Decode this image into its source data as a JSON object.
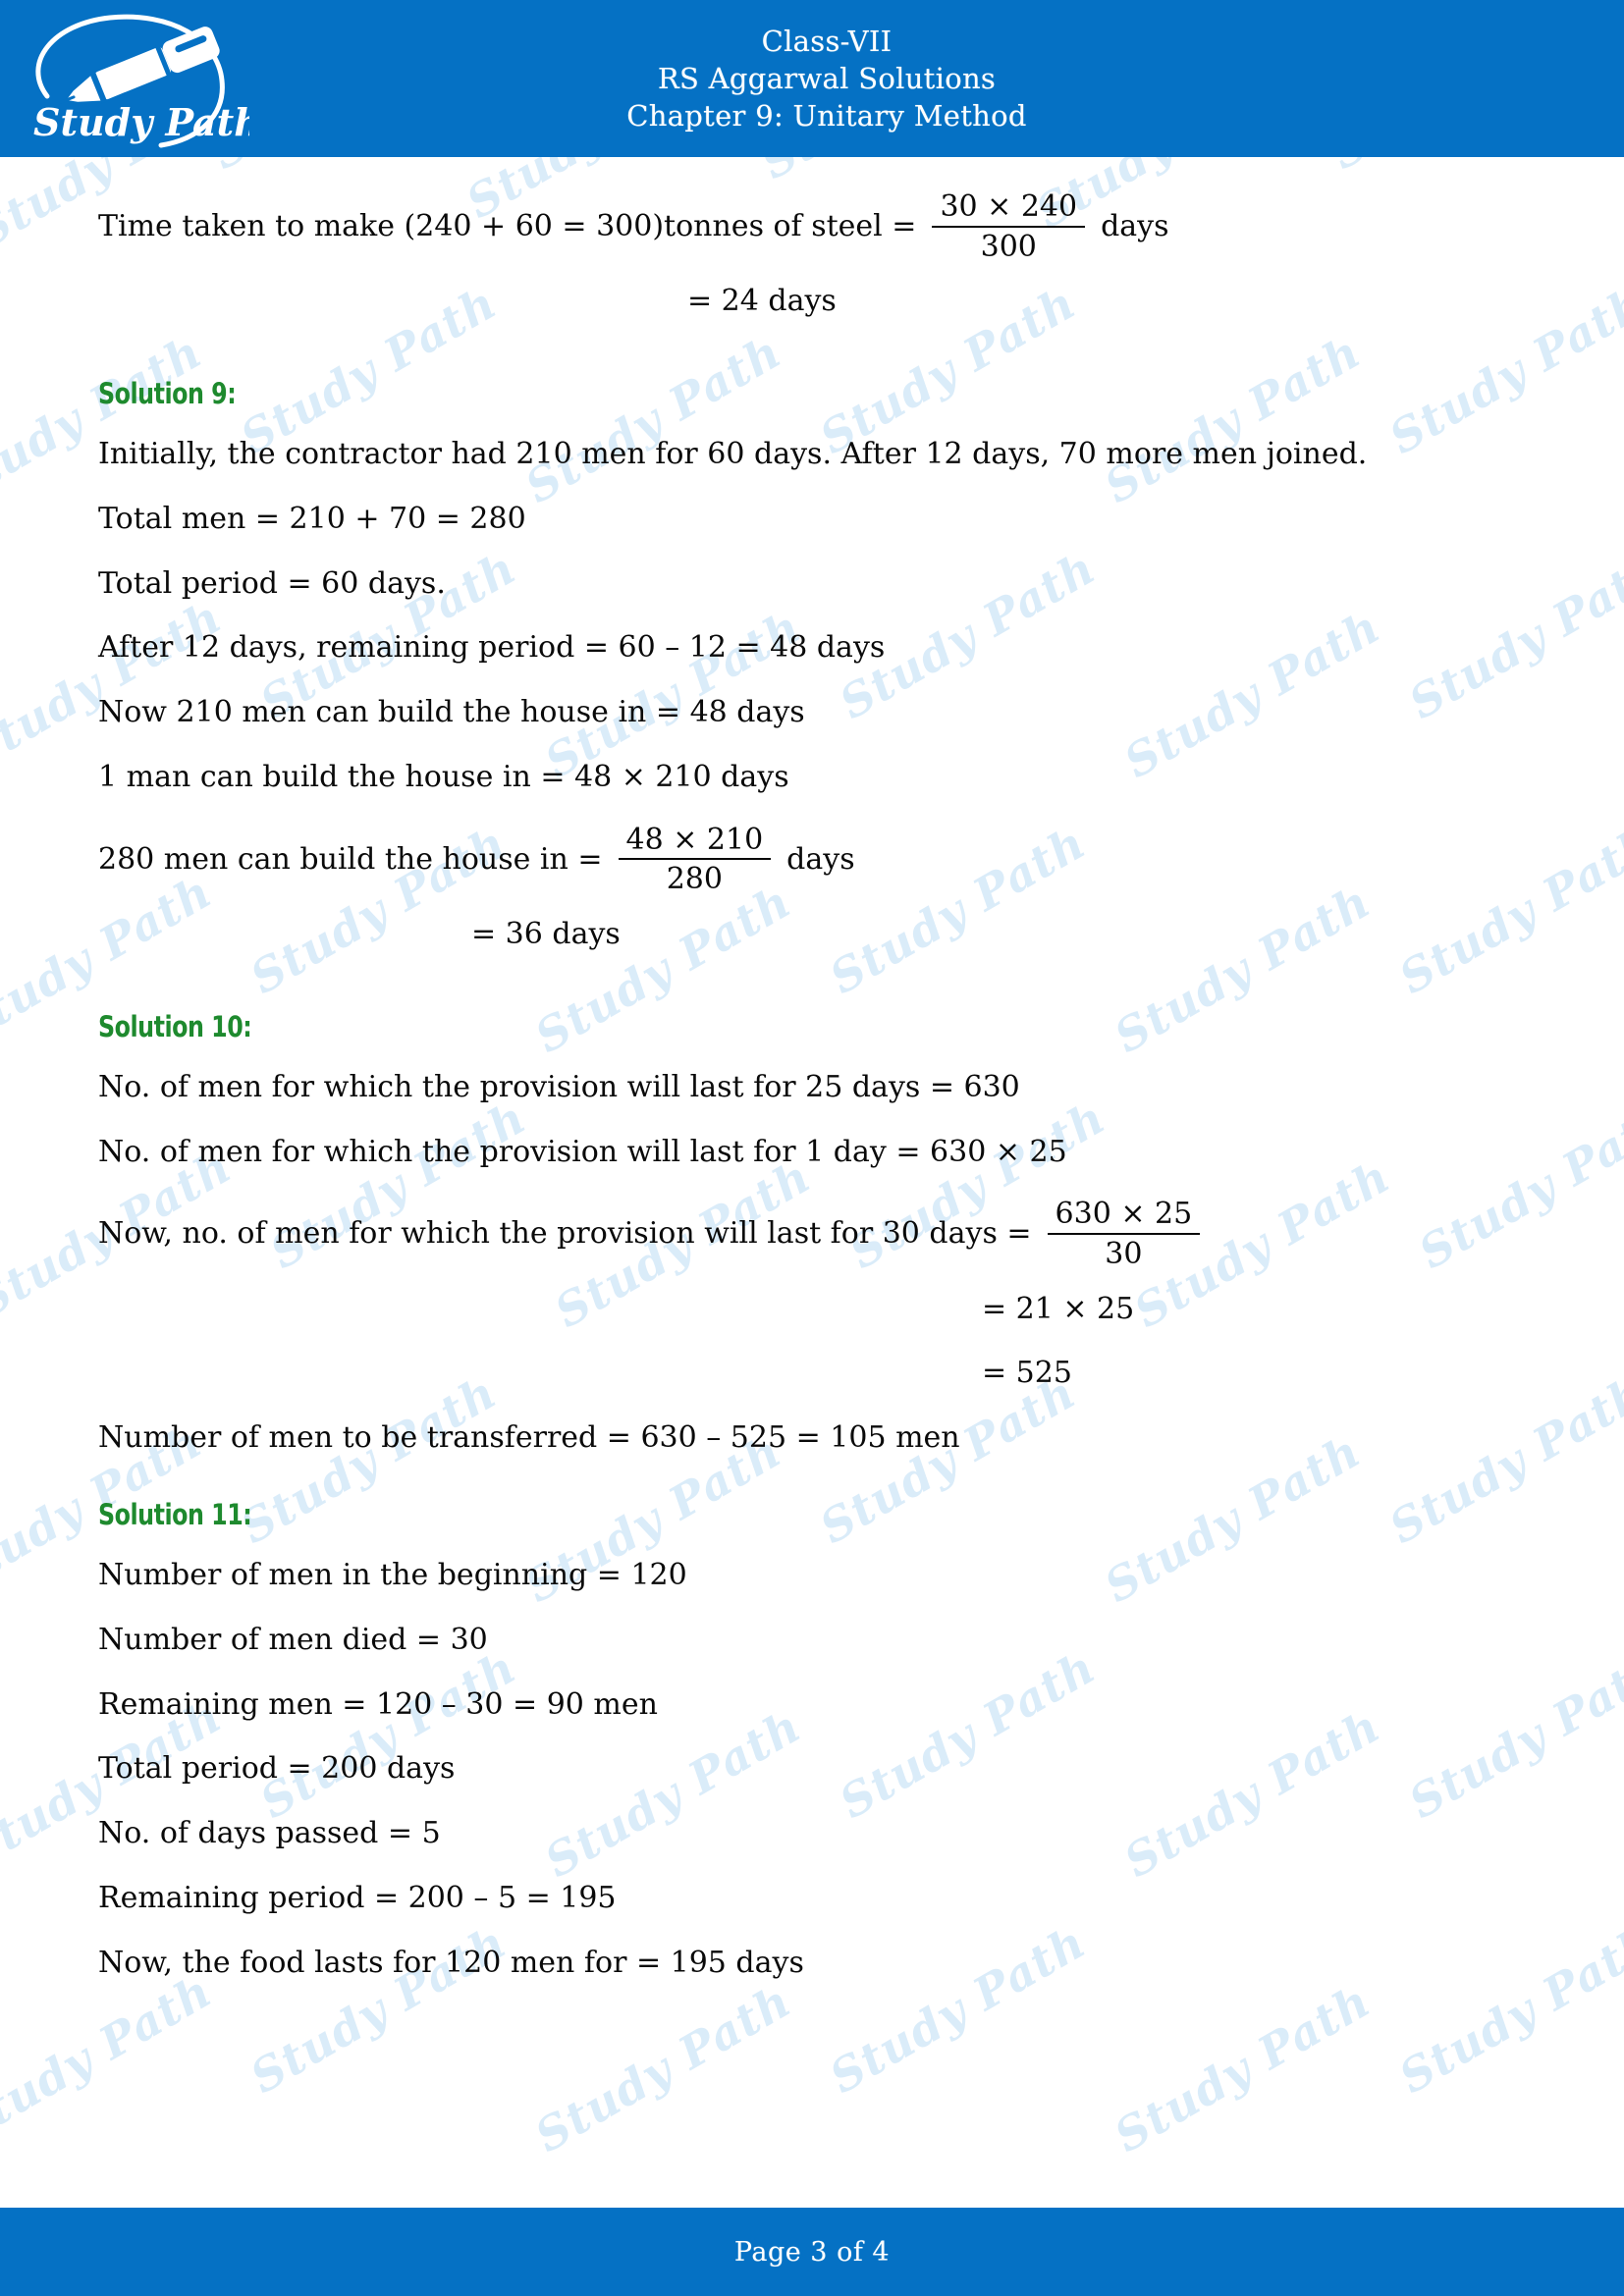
{
  "header": {
    "line1": "Class-VII",
    "line2": "RS Aggarwal Solutions",
    "line3": "Chapter 9: Unitary Method",
    "logo_text": "Study Path",
    "background_color": "#0571c4"
  },
  "watermark": {
    "text": "Study Path",
    "color": "#d9ebf9"
  },
  "body": {
    "carryover": {
      "lead": "Time taken to make (240 + 60 = 300)tonnes of steel =",
      "frac_num": "30 × 240",
      "frac_den": "300",
      "unit": "days",
      "result": "= 24 days"
    },
    "solution9": {
      "heading": "Solution 9:",
      "l1": "Initially, the contractor had 210 men for 60 days. After 12 days, 70 more men joined.",
      "l2": "Total men = 210 + 70 = 280",
      "l3": "Total period = 60 days.",
      "l4": "After 12 days, remaining period = 60 – 12 = 48 days",
      "l5": "Now 210 men can build the house in = 48 days",
      "l6": "1 man can build the house in = 48 × 210 days",
      "l7_lead": "280 men can build the house in =",
      "l7_num": "48 × 210",
      "l7_den": "280",
      "l7_unit": "days",
      "l8": "= 36 days"
    },
    "solution10": {
      "heading": "Solution 10:",
      "l1": "No. of men for which the provision will last for 25 days = 630",
      "l2": "No. of men for which the provision will last for 1 day = 630 × 25",
      "l3_lead": "Now, no. of men for which the provision will last for 30 days =",
      "l3_num": "630 × 25",
      "l3_den": "30",
      "l4": "= 21 × 25",
      "l5": "= 525",
      "l6": "Number of men to be transferred = 630 – 525 = 105 men"
    },
    "solution11": {
      "heading": "Solution 11:",
      "l1": "Number of men in the beginning = 120",
      "l2": "Number of men died = 30",
      "l3": "Remaining men = 120 – 30 = 90 men",
      "l4": "Total period = 200 days",
      "l5": "No. of days passed = 5",
      "l6": "Remaining period = 200 – 5 = 195",
      "l7": "Now, the food lasts for 120 men for = 195 days"
    }
  },
  "footer": {
    "text": "Page 3 of 4",
    "background_color": "#0571c4"
  }
}
